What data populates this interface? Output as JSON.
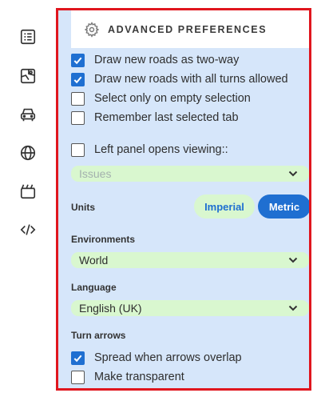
{
  "rail": {
    "icons": [
      "list-icon",
      "map-icon",
      "car-icon",
      "globe-icon",
      "clapperboard-icon",
      "code-icon"
    ]
  },
  "panel": {
    "title": "ADVANCED PREFERENCES",
    "checkboxes": [
      {
        "label": "Draw new roads as two-way",
        "checked": true
      },
      {
        "label": "Draw new roads with all turns allowed",
        "checked": true
      },
      {
        "label": "Select only on empty selection",
        "checked": false
      },
      {
        "label": "Remember last selected tab",
        "checked": false
      },
      {
        "label": "Left panel opens viewing::",
        "checked": false
      }
    ],
    "left_panel_select": {
      "value": "Issues",
      "disabled": true
    },
    "units": {
      "label": "Units",
      "options": [
        "Imperial",
        "Metric"
      ],
      "selected": "Metric"
    },
    "environments": {
      "label": "Environments",
      "value": "World"
    },
    "language": {
      "label": "Language",
      "value": "English (UK)"
    },
    "turn_arrows": {
      "label": "Turn arrows",
      "options": [
        {
          "label": "Spread when arrows overlap",
          "checked": true
        },
        {
          "label": "Make transparent",
          "checked": false
        }
      ]
    }
  },
  "colors": {
    "border": "#e0161e",
    "panel_bg": "#d6e6fa",
    "accent": "#1f6fd1",
    "select_bg": "#d9f7cf"
  }
}
